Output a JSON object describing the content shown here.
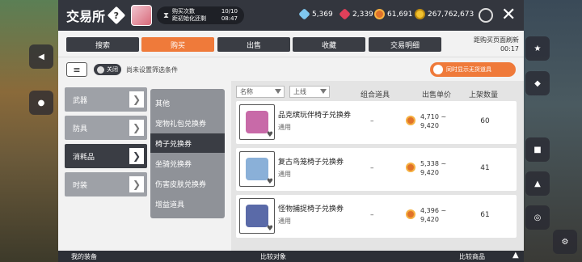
{
  "header": {
    "title": "交易所",
    "help_symbol": "?",
    "buy_count_label": "购买次数",
    "buy_count_value": "10/10",
    "reset_label": "距初始化还剩",
    "reset_value": "08:47",
    "currencies": [
      {
        "name": "diamond-icon",
        "value": "5,369"
      },
      {
        "name": "ruby-icon",
        "value": "2,339"
      },
      {
        "name": "coin-icon",
        "value": "61,691"
      },
      {
        "name": "meso-icon",
        "value": "267,762,673"
      }
    ],
    "close_symbol": "✕"
  },
  "tabs": [
    "搜索",
    "购买",
    "出售",
    "收藏",
    "交易明细"
  ],
  "active_tab": "购买",
  "refresh": {
    "label": "距购买页面刷新",
    "time": "00:17"
  },
  "filter": {
    "filter_icon": "≡",
    "toggle_label": "关闭",
    "status_text": "尚未设置筛选条件",
    "show_unavailable_label": "同时显示无货道具"
  },
  "categories": [
    "武器",
    "防具",
    "消耗品",
    "时装"
  ],
  "active_category": "消耗品",
  "subcategories": [
    "其他",
    "宠物礼包兑换券",
    "椅子兑换券",
    "坐骑兑换券",
    "伤害皮肤兑换券",
    "增益道具"
  ],
  "active_subcategory": "椅子兑换券",
  "list_header": {
    "name_select": "名称",
    "level_select": "上线",
    "col_combo": "组合道具",
    "col_price": "出售单价",
    "col_qty": "上架数量"
  },
  "items": [
    {
      "name": "品克缤玩伴椅子兑换券",
      "tag": "通用",
      "combo": "–",
      "price_min": "4,710 ~",
      "price_max": "9,420",
      "qty": "60",
      "art_color": "#c86aa8"
    },
    {
      "name": "复古鸟笼椅子兑换券",
      "tag": "通用",
      "combo": "–",
      "price_min": "5,338 ~",
      "price_max": "9,420",
      "qty": "41",
      "art_color": "#8ab0d8"
    },
    {
      "name": "怪物捕捉椅子兑换券",
      "tag": "通用",
      "combo": "–",
      "price_min": "4,396 ~",
      "price_max": "9,420",
      "qty": "61",
      "art_color": "#5a6aa8"
    }
  ],
  "bottom_bar": {
    "left": "我的装备",
    "middle": "比较对象",
    "right": "比较商品",
    "up_symbol": "▲"
  },
  "colors": {
    "accent": "#ef7a3a",
    "dark": "#3a3d44"
  }
}
